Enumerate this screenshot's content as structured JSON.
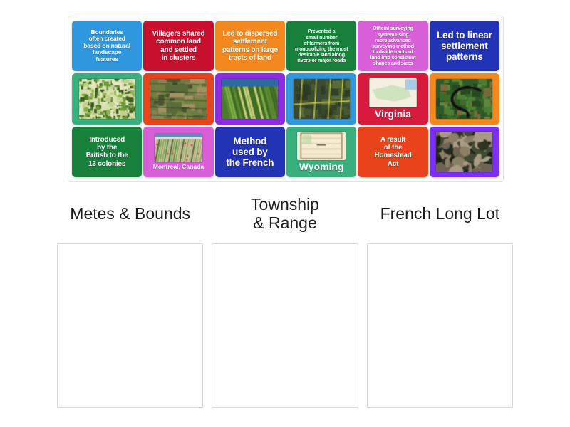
{
  "activity": {
    "type": "group-sort",
    "tray_label": "word-bank"
  },
  "cards": [
    {
      "id": "c1",
      "kind": "text",
      "bg": "#2e97de",
      "size": "fs-sm",
      "text": "Boundaries\noften created\nbased on natural\nlandscape\nfeatures"
    },
    {
      "id": "c2",
      "kind": "text",
      "bg": "#c8102e",
      "size": "fs-md",
      "text": "Villagers shared\ncommon land\nand settled\nin clusters"
    },
    {
      "id": "c3",
      "kind": "text",
      "bg": "#f3881f",
      "size": "fs-md",
      "text": "Led to dispersed\nsettlement\npatterns on large\ntracts of land"
    },
    {
      "id": "c4",
      "kind": "text",
      "bg": "#17813c",
      "size": "fs-xs",
      "text": "Prevented a\nsmall number\nof farmers from\nmonopolizing the most\ndesirable land along\nrivers or major roads"
    },
    {
      "id": "c5",
      "kind": "text",
      "bg": "#d95fd8",
      "size": "fs-xs",
      "text": "Official surveying\nsystem using\nmore advanced\nsurveying method\nto divide tracts of\nland into consistent\nshapes and sizes"
    },
    {
      "id": "c6",
      "kind": "text",
      "bg": "#2233b5",
      "size": "fs-lg",
      "text": "Led to linear\nsettlement\npatterns"
    },
    {
      "id": "c7",
      "kind": "image",
      "bg": "#3aaf7e",
      "thumb": "satellite-patchwork-fields",
      "alt": "satellite view of irregular patchwork farm fields"
    },
    {
      "id": "c8",
      "kind": "image",
      "bg": "#e8431a",
      "thumb": "aerial-rectangular-farmland",
      "alt": "aerial photo of rectangular farmland grid"
    },
    {
      "id": "c9",
      "kind": "image",
      "bg": "#8b2ce0",
      "thumb": "aerial-long-lots-river",
      "alt": "aerial photo of long narrow lots along a river"
    },
    {
      "id": "c10",
      "kind": "image",
      "bg": "#2e97de",
      "thumb": "aerial-survey-parcel-lines",
      "alt": "aerial photo with yellow survey parcel lines"
    },
    {
      "id": "c11",
      "kind": "caption",
      "bg": "#d81b3c",
      "thumb": "map-virginia",
      "caption": "Virginia",
      "caption_size": "cap-lg"
    },
    {
      "id": "c12",
      "kind": "image",
      "bg": "#f3881f",
      "thumb": "satellite-curved-road-ridge",
      "alt": "satellite view of a curved road across forested ridges"
    },
    {
      "id": "c13",
      "kind": "text",
      "bg": "#17813c",
      "size": "fs-md",
      "text": "Introduced\nby the\nBritish to the\n13 colonies"
    },
    {
      "id": "c14",
      "kind": "caption",
      "bg": "#d95fd8",
      "thumb": "aerial-montreal-long-lots",
      "caption": "Montreal, Canada",
      "caption_size": "cap-sm"
    },
    {
      "id": "c15",
      "kind": "text",
      "bg": "#2233b5",
      "size": "fs-lg",
      "text": "Method\nused by\nthe French"
    },
    {
      "id": "c16",
      "kind": "caption",
      "bg": "#3aaf7e",
      "thumb": "map-wyoming",
      "caption": "Wyoming",
      "caption_size": "cap-lg"
    },
    {
      "id": "c17",
      "kind": "text",
      "bg": "#e8431a",
      "size": "fs-md",
      "text": "A result\nof the\nHomestead\nAct"
    },
    {
      "id": "c18",
      "kind": "image",
      "bg": "#7b2ff2",
      "thumb": "camouflage-terrain-pattern",
      "alt": "dark camouflage-like terrain pattern"
    }
  ],
  "categories": [
    {
      "id": "cat1",
      "title": "Metes & Bounds"
    },
    {
      "id": "cat2",
      "title": "Township\n& Range"
    },
    {
      "id": "cat3",
      "title": "French Long Lot"
    }
  ]
}
